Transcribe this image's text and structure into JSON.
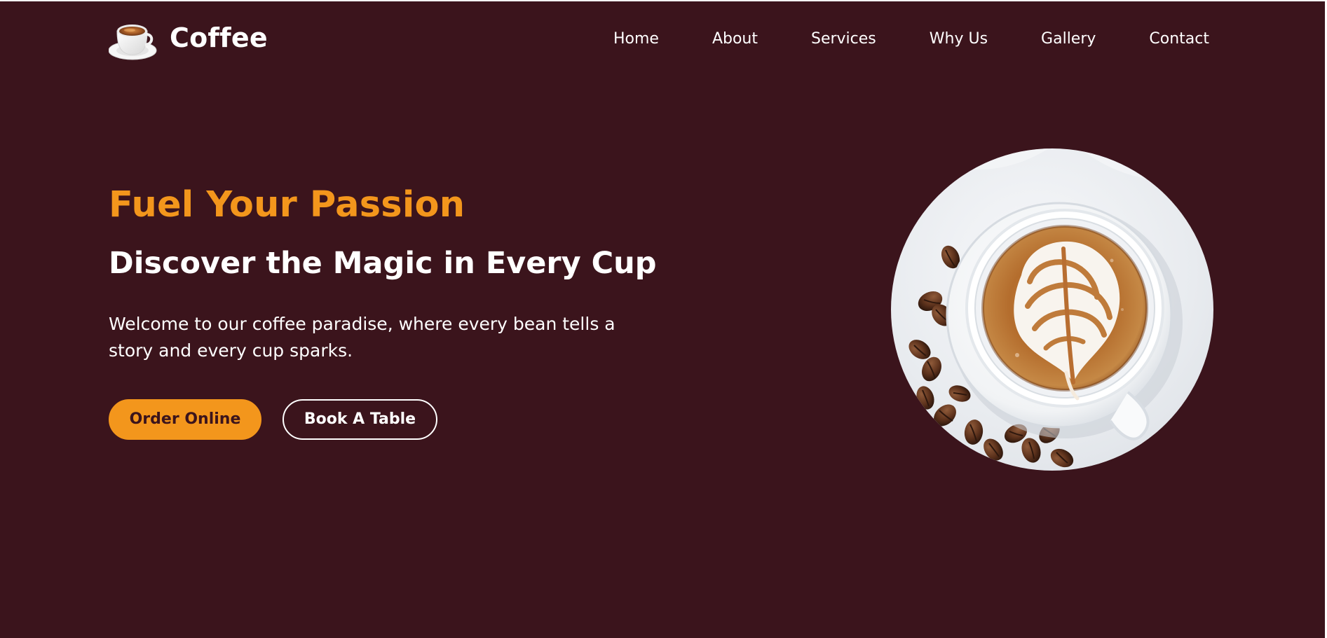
{
  "brand": {
    "name": "Coffee",
    "logo_icon": "coffee-cup-icon"
  },
  "nav": {
    "items": [
      {
        "label": "Home"
      },
      {
        "label": "About"
      },
      {
        "label": "Services"
      },
      {
        "label": "Why Us"
      },
      {
        "label": "Gallery"
      },
      {
        "label": "Contact"
      }
    ]
  },
  "hero": {
    "tag": "Fuel Your Passion",
    "title": "Discover the Magic in Every Cup",
    "description": "Welcome to our coffee paradise, where every bean tells a story and every cup sparks.",
    "buttons": {
      "primary_label": "Order Online",
      "secondary_label": "Book A Table"
    },
    "image_icon": "latte-art-coffee-cup-image"
  },
  "colors": {
    "background": "#3b141c",
    "accent": "#f3961c",
    "text": "#ffffff"
  }
}
